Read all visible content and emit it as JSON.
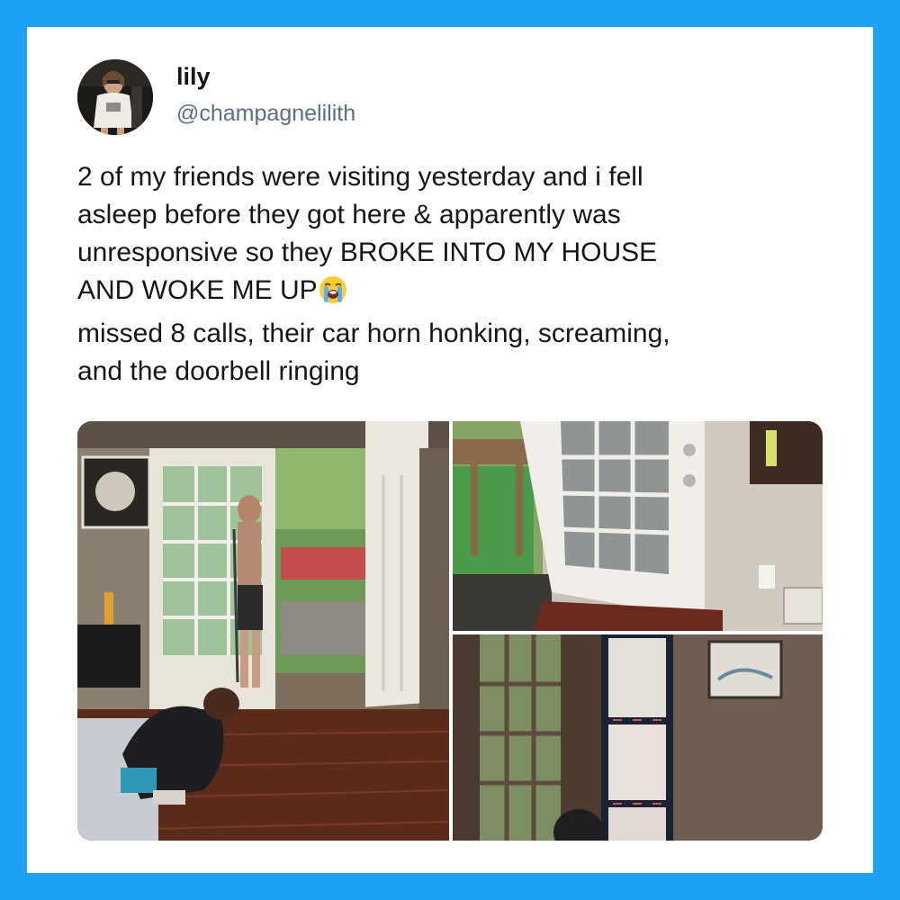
{
  "tweet": {
    "author": {
      "display_name": "lily",
      "handle": "@champagnelilith",
      "avatar_icon": "profile-photo"
    },
    "text_lines": [
      "2 of my friends were visiting yesterday and i fell",
      "asleep before they got here & apparently was",
      "unresponsive so they BROKE INTO MY HOUSE",
      "AND WOKE ME UP",
      "missed 8 calls, their car horn honking, screaming,",
      "and the doorbell ringing"
    ],
    "emoji_icon": "loudly-crying-face-icon",
    "media": [
      {
        "description_icon": "photo-friends-in-living-room"
      },
      {
        "description_icon": "photo-open-french-door"
      },
      {
        "description_icon": "photo-taped-broken-window"
      }
    ]
  },
  "colors": {
    "frame": "#1da1f2",
    "card": "#ffffff",
    "text": "#14171a",
    "handle": "#5b7083"
  }
}
